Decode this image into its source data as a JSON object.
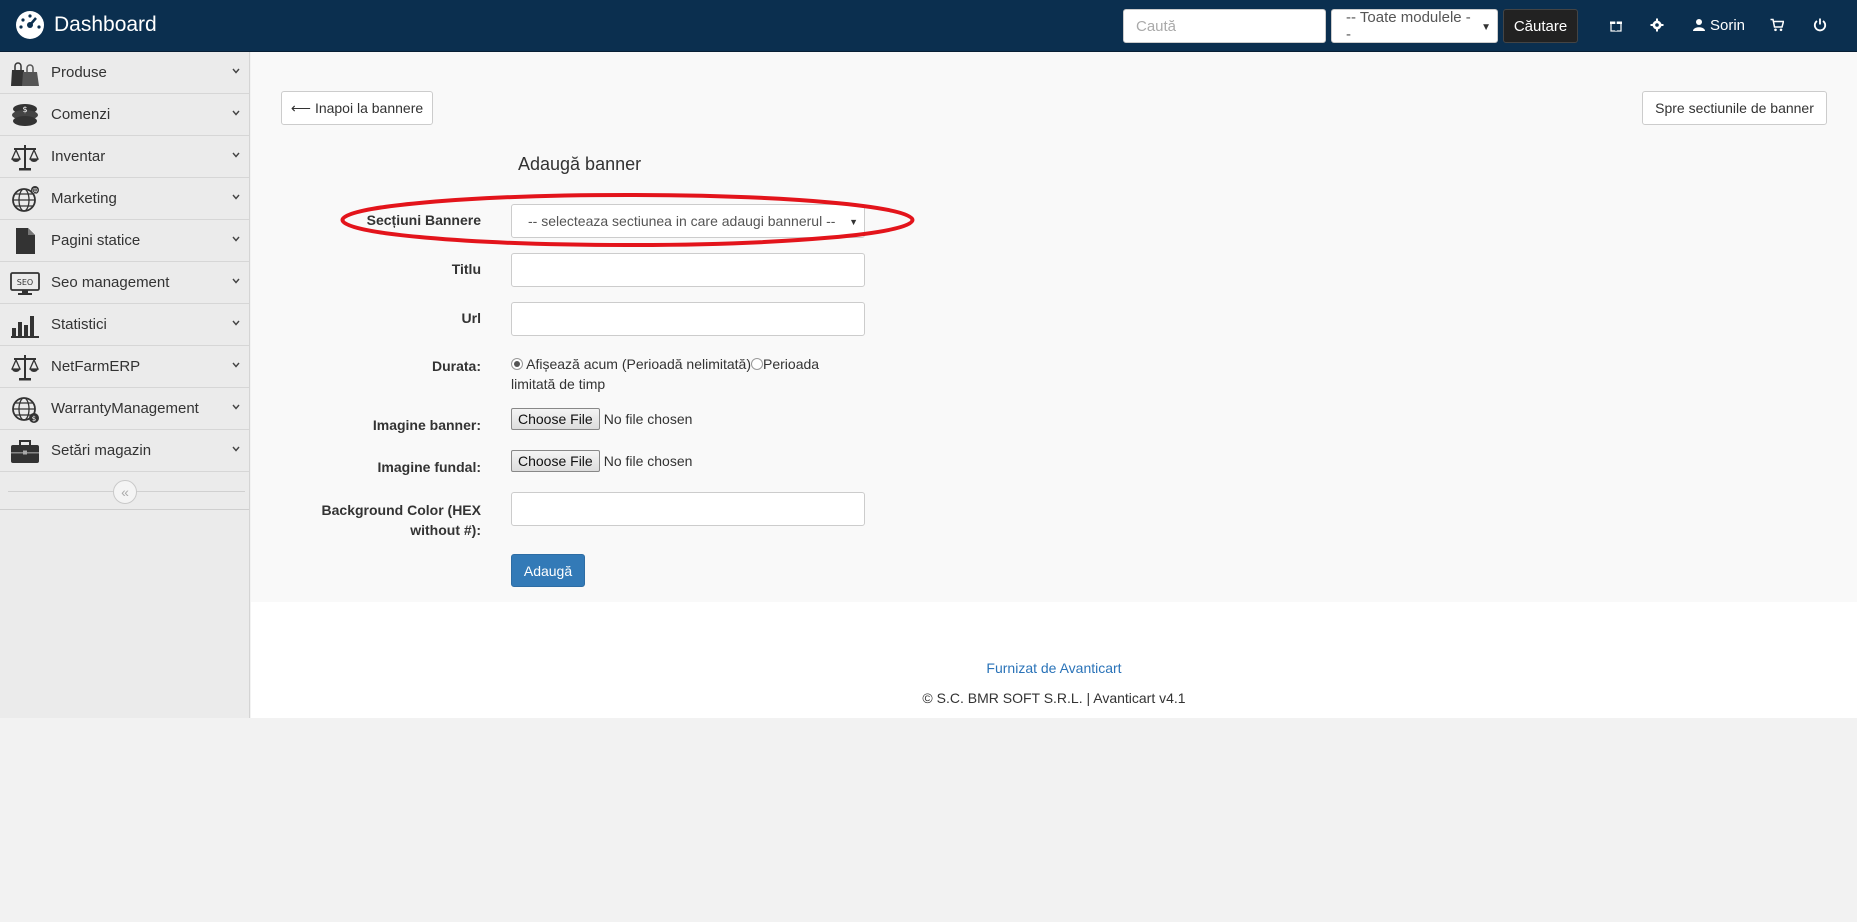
{
  "navbar": {
    "brand": "Dashboard",
    "search_placeholder": "Caută",
    "module_select": "-- Toate modulele --",
    "search_button": "Căutare",
    "user_name": "Sorin"
  },
  "sidebar": {
    "items": [
      {
        "label": "Produse",
        "icon": "shopping-bags-icon"
      },
      {
        "label": "Comenzi",
        "icon": "coins-icon"
      },
      {
        "label": "Inventar",
        "icon": "scale-icon"
      },
      {
        "label": "Marketing",
        "icon": "globe-icon"
      },
      {
        "label": "Pagini statice",
        "icon": "document-icon"
      },
      {
        "label": "Seo management",
        "icon": "seo-monitor-icon"
      },
      {
        "label": "Statistici",
        "icon": "bar-chart-icon"
      },
      {
        "label": "NetFarmERP",
        "icon": "scale-icon"
      },
      {
        "label": "WarrantyManagement",
        "icon": "globe-dollar-icon"
      },
      {
        "label": "Setări magazin",
        "icon": "briefcase-icon"
      }
    ]
  },
  "main": {
    "back_button": "Inapoi la bannere",
    "sections_button": "Spre sectiunile de banner",
    "form_title": "Adaugă banner",
    "fields": {
      "sections_label": "Secțiuni Bannere",
      "sections_placeholder": "-- selecteaza sectiunea in care adaugi bannerul --",
      "title_label": "Titlu",
      "url_label": "Url",
      "duration_label": "Durata:",
      "duration_option_now": "Afișează acum (Perioadă nelimitată)",
      "duration_option_limited": "Perioada limitată de timp",
      "image_banner_label": "Imagine banner:",
      "image_background_label": "Imagine fundal:",
      "choose_file": "Choose File",
      "no_file": "No file chosen",
      "bg_color_label_line1": "Background Color (HEX",
      "bg_color_label_line2": "without #):",
      "submit": "Adaugă"
    },
    "annotation_color": "#e3141b"
  },
  "footer": {
    "link": "Furnizat de Avanticart",
    "copyright": "© S.C. BMR SOFT S.R.L. | Avanticart v4.1"
  }
}
